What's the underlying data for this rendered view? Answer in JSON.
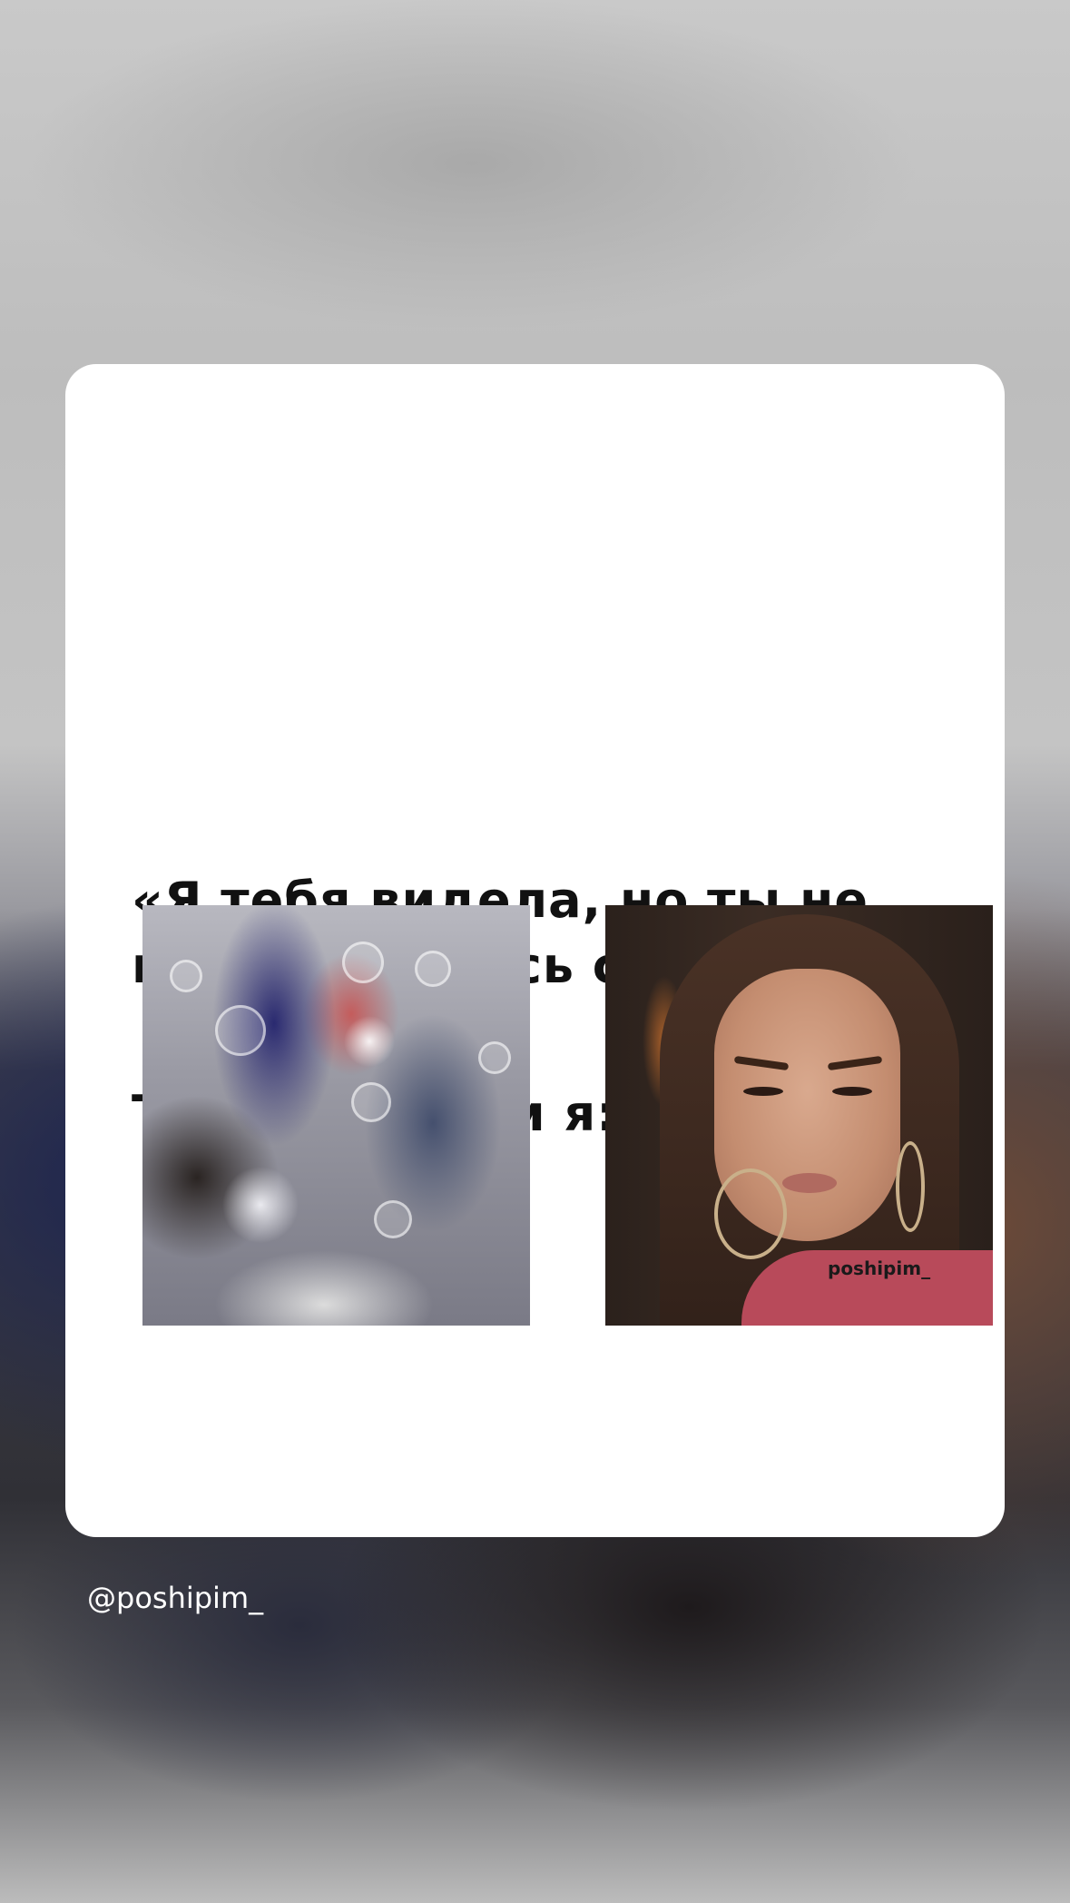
{
  "post": {
    "caption_line_1": "«Я тебя видела, но ты не поздоровалась со мной»",
    "caption_line_2": "Тем временем я:",
    "image_watermark": "poshipim_"
  },
  "footer": {
    "username": "@poshipim_"
  }
}
